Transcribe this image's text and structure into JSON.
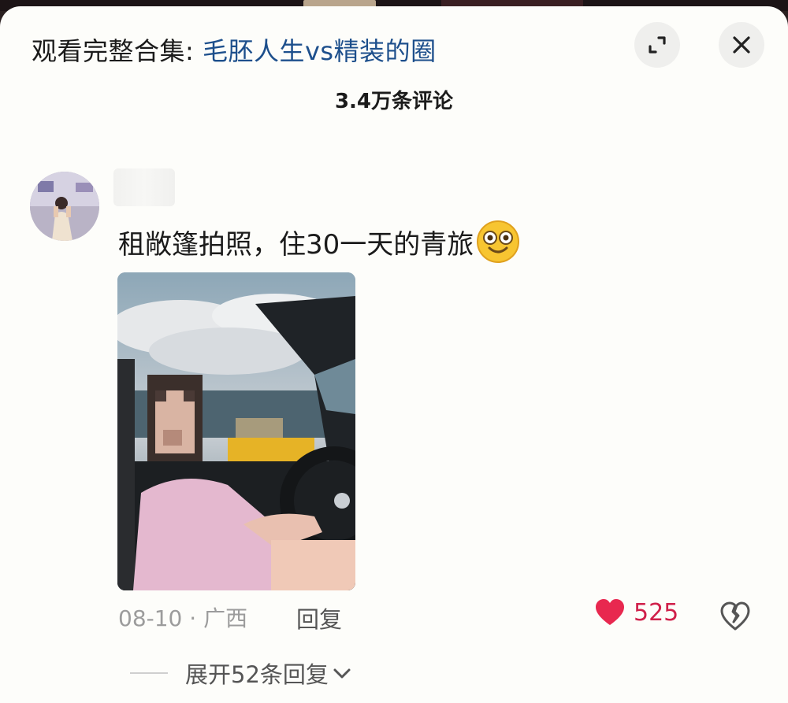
{
  "header": {
    "prefix": "观看完整合集: ",
    "collection_link": "毛胚人生vs精装的圈"
  },
  "comments_count": "3.4万条评论",
  "comment": {
    "text": "租敞篷拍照，住30一天的青旅",
    "date_location": "08-10 · 广西",
    "reply_label": "回复",
    "like_count": "525",
    "expand_replies_label": "展开52条回复"
  },
  "colors": {
    "link": "#1d4f8c",
    "like": "#d0204a"
  },
  "icons": [
    "expand-icon",
    "close-icon",
    "heart-icon",
    "broken-heart-icon",
    "chevron-down-icon",
    "smile-emoji-icon"
  ]
}
